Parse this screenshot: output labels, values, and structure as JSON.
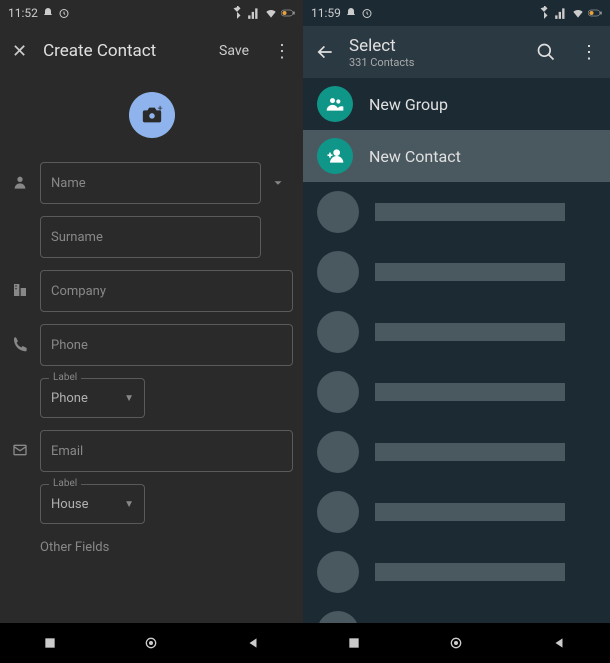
{
  "left": {
    "status": {
      "time": "11:52",
      "hasAlarm": true
    },
    "header": {
      "title": "Create Contact",
      "save": "Save"
    },
    "fields": {
      "name": "Name",
      "surname": "Surname",
      "company": "Company",
      "phone": "Phone",
      "phone_label_title": "Label",
      "phone_label_value": "Phone",
      "email": "Email",
      "email_label_title": "Label",
      "email_label_value": "House"
    },
    "other": "Other Fields"
  },
  "right": {
    "status": {
      "time": "11:59",
      "hasAlarm": true
    },
    "header": {
      "title": "Select",
      "subtitle": "331 Contacts"
    },
    "actions": {
      "newGroup": "New Group",
      "newContact": "New Contact"
    },
    "contactPlaceholders": 8
  }
}
